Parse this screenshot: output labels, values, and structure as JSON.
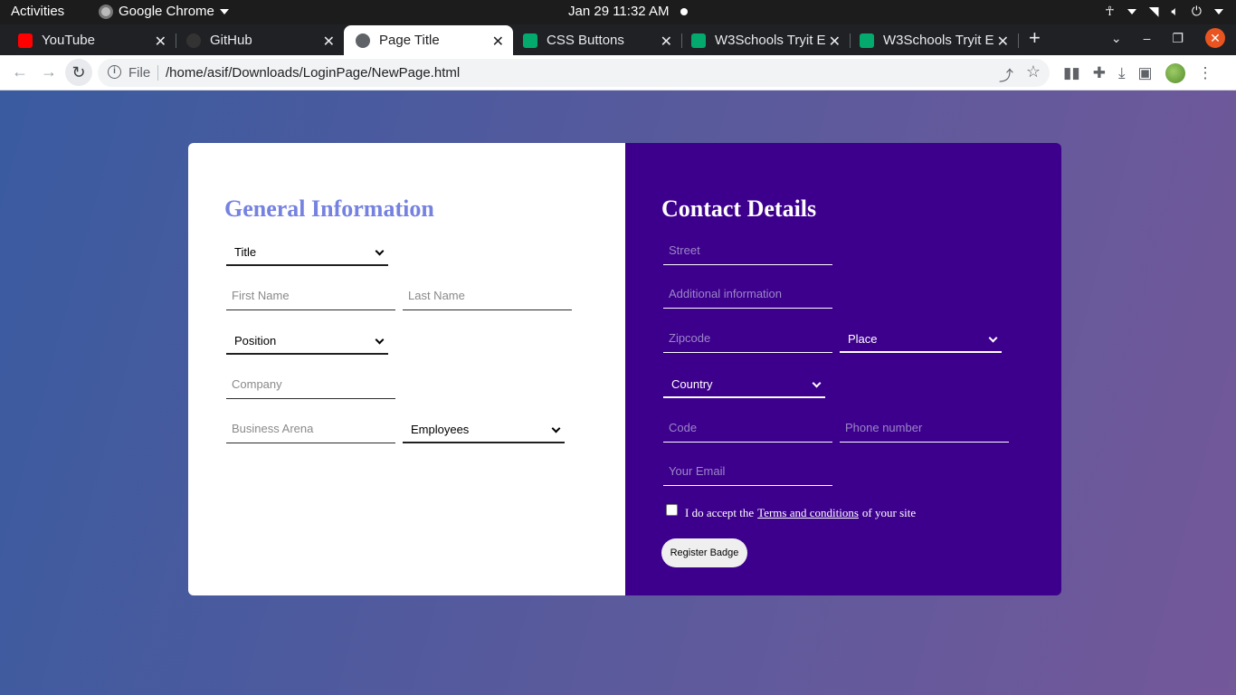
{
  "system_bar": {
    "activities": "Activities",
    "app_name": "Google Chrome",
    "clock": "Jan 29  11:32 AM"
  },
  "tabs": [
    {
      "title": "YouTube",
      "favicon_color": "#ff0000"
    },
    {
      "title": "GitHub",
      "favicon_color": "#333333"
    },
    {
      "title": "Page Title",
      "favicon_color": "#5f6368"
    },
    {
      "title": "CSS Buttons",
      "favicon_color": "#04aa6d"
    },
    {
      "title": "W3Schools Tryit E",
      "favicon_color": "#04aa6d"
    },
    {
      "title": "W3Schools Tryit E",
      "favicon_color": "#04aa6d"
    }
  ],
  "address_bar": {
    "scheme_label": "File",
    "url": "/home/asif/Downloads/LoginPage/NewPage.html"
  },
  "general": {
    "heading": "General Information",
    "title_select": "Title",
    "first_name_placeholder": "First Name",
    "last_name_placeholder": "Last Name",
    "position_select": "Position",
    "company_placeholder": "Company",
    "business_arena_placeholder": "Business Arena",
    "employees_select": "Employees"
  },
  "contact": {
    "heading": "Contact Details",
    "street_placeholder": "Street",
    "additional_placeholder": "Additional information",
    "zipcode_placeholder": "Zipcode",
    "place_select": "Place",
    "country_select": "Country",
    "code_placeholder": "Code",
    "phone_placeholder": "Phone number",
    "email_placeholder": "Your Email",
    "terms_prefix": "I do accept the",
    "terms_link": "Terms and conditions",
    "terms_suffix": "of your site",
    "register_button": "Register Badge"
  },
  "colors": {
    "page_gradient_start": "#3a5ba0",
    "page_gradient_end": "#73589a",
    "left_panel": "#ffffff",
    "right_panel": "#3d008c",
    "left_heading": "#7582e0",
    "os_close_button": "#e95420"
  }
}
